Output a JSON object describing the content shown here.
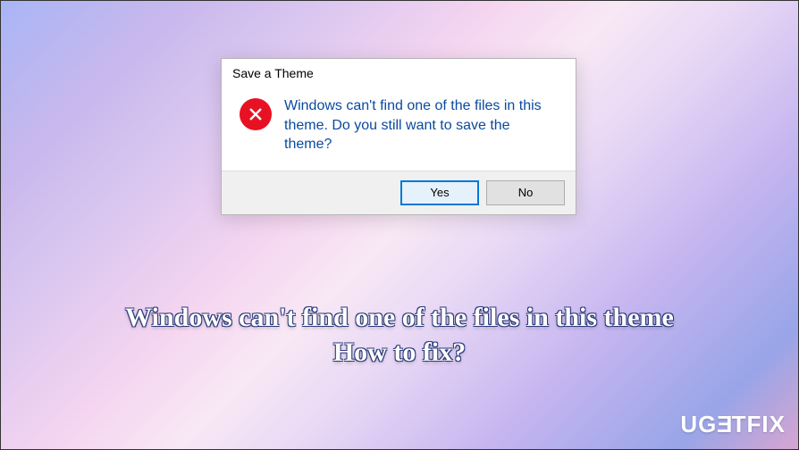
{
  "dialog": {
    "title": "Save a Theme",
    "message": "Windows can't find one of the files in this theme. Do you still want to save the theme?",
    "yes_label": "Yes",
    "no_label": "No"
  },
  "caption": {
    "line1": "Windows can't find one of the files in this theme",
    "line2": "How to fix?"
  },
  "watermark": {
    "text_prefix": "UG",
    "text_e": "E",
    "text_suffix": "TFIX"
  },
  "icons": {
    "error": "error-x-icon"
  }
}
